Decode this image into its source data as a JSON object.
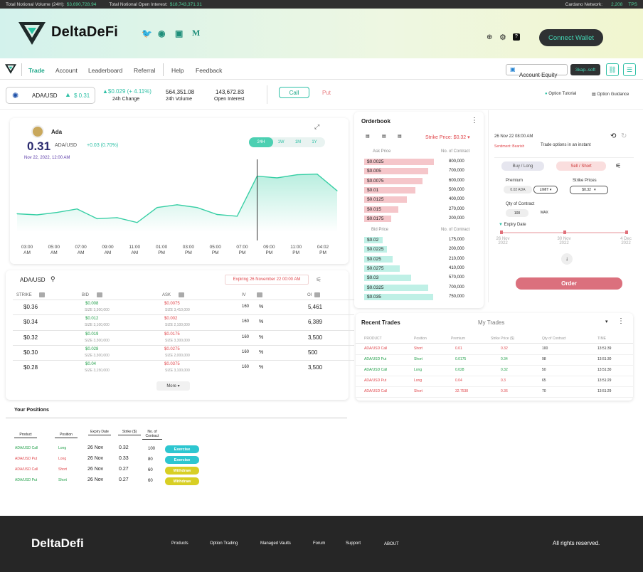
{
  "ticker": {
    "vol_label": "Total Notional Volume (24H):",
    "vol": "$3,690,728.94",
    "oi_label": "Total Notional Open Interest:",
    "oi": "$18,743,371.31",
    "network_label": "Cardano Network:",
    "tps": "2,208",
    "tps_unit": "TPS"
  },
  "header": {
    "brand": "DeltaDeFi",
    "connect": "Connect Wallet"
  },
  "nav": {
    "items": [
      "Trade",
      "Account",
      "Leaderboard",
      "Referral",
      "Help",
      "Feedback"
    ],
    "equity": "Account Equity",
    "addr": "3kap..soft"
  },
  "market": {
    "pair": "ADA/USD",
    "price": "$ 0.31",
    "change": "$0.029 (+ 4.11%)",
    "change_label": "24h Change",
    "vol": "564,351.08",
    "vol_label": "24h Volume",
    "oi": "143,672.83",
    "oi_label": "Open Interest",
    "call": "Call",
    "put": "Put",
    "tutorial": "Option Tutorial",
    "guidance": "Option Guidance"
  },
  "chart": {
    "name": "Ada",
    "price": "0.31",
    "pair": "ADA/USD",
    "delta": "+0.03 (0.70%)",
    "date": "Nov 22, 2022, 12:00 AM",
    "ranges": [
      "24H",
      "1W",
      "1M",
      "1Y"
    ]
  },
  "chart_data": {
    "type": "area",
    "x": [
      "03:00 AM",
      "05:00 AM",
      "07:00 AM",
      "09:00 AM",
      "11:00 AM",
      "01:00 PM",
      "03:00 PM",
      "05:00 PM",
      "07:00 PM",
      "09:00 PM",
      "11:00 PM",
      "04:02 PM"
    ],
    "xticks": [
      [
        "03:00",
        "AM"
      ],
      [
        "05:00",
        "AM"
      ],
      [
        "07:00",
        "AM"
      ],
      [
        "09:00",
        "AM"
      ],
      [
        "11:00",
        "AM"
      ],
      [
        "01:00",
        "PM"
      ],
      [
        "03:00",
        "PM"
      ],
      [
        "05:00",
        "PM"
      ],
      [
        "07:00",
        "PM"
      ],
      [
        "09:00",
        "PM"
      ],
      [
        "11:00",
        "PM"
      ],
      [
        "04:02",
        "PM"
      ]
    ],
    "points": [
      0.232,
      0.229,
      0.236,
      0.246,
      0.218,
      0.221,
      0.207,
      0.25,
      0.258,
      0.25,
      0.23,
      0.225,
      0.34,
      0.335,
      0.344,
      0.346,
      0.298
    ],
    "ylim": [
      0.18,
      0.38
    ],
    "color": "#38cfa5"
  },
  "options": {
    "pair": "ADA/USD",
    "expiry": "Expiring 26 November 22 00:00 AM",
    "headers": [
      "STRIKE",
      "BID",
      "ASK",
      "IV",
      "OI"
    ],
    "rows": [
      {
        "strike": "$0.36",
        "bid": "$0.008",
        "bid_size": "SIZE  3,300,000",
        "ask": "$0.0075",
        "ask_size": "SIZE  3,410,000",
        "iv": "160",
        "pct": "%",
        "oi": "5,461"
      },
      {
        "strike": "$0.34",
        "bid": "$0.012",
        "bid_size": "SIZE  3,100,000",
        "ask": "$0.002",
        "ask_size": "SIZE  2,100,000",
        "iv": "160",
        "pct": "%",
        "oi": "6,389"
      },
      {
        "strike": "$0.32",
        "bid": "$0.019",
        "bid_size": "SIZE  3,300,000",
        "ask": "$0.0175",
        "ask_size": "SIZE  3,300,000",
        "iv": "160",
        "pct": "%",
        "oi": "3,500"
      },
      {
        "strike": "$0.30",
        "bid": "$0.028",
        "bid_size": "SIZE  3,300,000",
        "ask": "$0.0275",
        "ask_size": "SIZE  2,000,000",
        "iv": "160",
        "pct": "%",
        "oi": "500"
      },
      {
        "strike": "$0.28",
        "bid": "$0.04",
        "bid_size": "SIZE  3,150,000",
        "ask": "$0.0375",
        "ask_size": "SIZE  3,100,000",
        "iv": "160",
        "pct": "%",
        "oi": "3,500"
      }
    ],
    "more": "More"
  },
  "orderbook": {
    "title": "Orderbook",
    "strike": "Strike Price: $0.32",
    "ask_h": "Ask Price",
    "bid_h": "Bid Price",
    "qty_h": "No. of Contract",
    "asks": [
      [
        "$0.0025",
        "800,000",
        0.98
      ],
      [
        "$0.005",
        "700,000",
        0.9
      ],
      [
        "$0.0075",
        "600,000",
        0.82
      ],
      [
        "$0.01",
        "500,000",
        0.72
      ],
      [
        "$0.0125",
        "400,000",
        0.6
      ],
      [
        "$0.015",
        "270,000",
        0.48
      ],
      [
        "$0.0175",
        "200,000",
        0.38
      ]
    ],
    "bids": [
      [
        "$0.02",
        "175,000",
        0.26
      ],
      [
        "$0.0225",
        "200,000",
        0.32
      ],
      [
        "$0.025",
        "210,000",
        0.4
      ],
      [
        "$0.0275",
        "410,000",
        0.5
      ],
      [
        "$0.03",
        "570,000",
        0.66
      ],
      [
        "$0.0325",
        "700,000",
        0.9
      ],
      [
        "$0.035",
        "750,000",
        0.97
      ]
    ]
  },
  "trades": {
    "title": "Recent Trades",
    "my": "My Trades",
    "headers": [
      "PRODUCT",
      "Position",
      "Premium",
      "Strike Price ($)",
      "Qty of Contract",
      "TIME"
    ],
    "rows": [
      [
        "ADA/USD Call",
        "Short",
        "0.01",
        "0.32",
        "100",
        "13:51:39",
        "r"
      ],
      [
        "ADA/USD Put",
        "Short",
        "0.0175",
        "0.34",
        "98",
        "13:51:30",
        "g"
      ],
      [
        "ADA/USD Call",
        "Long",
        "0.028",
        "0.32",
        "50",
        "13:51:30",
        "g"
      ],
      [
        "ADA/USD Put",
        "Long",
        "0.04",
        "0.3",
        "65",
        "13:51:29",
        "r"
      ],
      [
        "ADA/USD Call",
        "Short",
        "32.7538",
        "0.36",
        "70",
        "13:51:29",
        "r"
      ]
    ]
  },
  "order": {
    "date": "26 Nov 22 08:00 AM",
    "sentiment": "Sentiment: Bearish",
    "tagline": "Trade options in an instant",
    "buy": "Buy / Long",
    "sell": "Sell / Short",
    "premium_label": "Premium",
    "premium": "0.02 ADA",
    "type": "LIMIT",
    "strike_label": "Strike Prices",
    "strike": "$0.32",
    "qty_label": "Qty of Contract",
    "qty": "100",
    "max": "MAX",
    "expiry_label": "Expiry Date",
    "dates": [
      "26 Nov 2022",
      "30 Nov 2022",
      "4 Dec 2022"
    ],
    "submit": "Order"
  },
  "positions": {
    "title": "Your Positions",
    "headers": [
      "Product",
      "Position",
      "Expiry Date",
      "Strike ($)",
      "No. of Contract"
    ],
    "rows": [
      [
        "ADA/USD Call",
        "Long",
        "26 Nov",
        "0.32",
        "100",
        "Exercise",
        "g"
      ],
      [
        "ADA/USD Put",
        "Long",
        "26 Nov",
        "0.33",
        "80",
        "Exercise",
        "r"
      ],
      [
        "ADA/USD Call",
        "Short",
        "26 Nov",
        "0.27",
        "60",
        "Withdraw",
        "r"
      ],
      [
        "ADA/USD Put",
        "Short",
        "26 Nov",
        "0.27",
        "60",
        "Withdraw",
        "g"
      ]
    ]
  },
  "footer": {
    "brand": "DeltaDefi",
    "links": [
      "Products",
      "Option Trading",
      "Managed Vaults",
      "Forum",
      "Support",
      "ABOUT"
    ],
    "rights": "All rights reserved."
  }
}
